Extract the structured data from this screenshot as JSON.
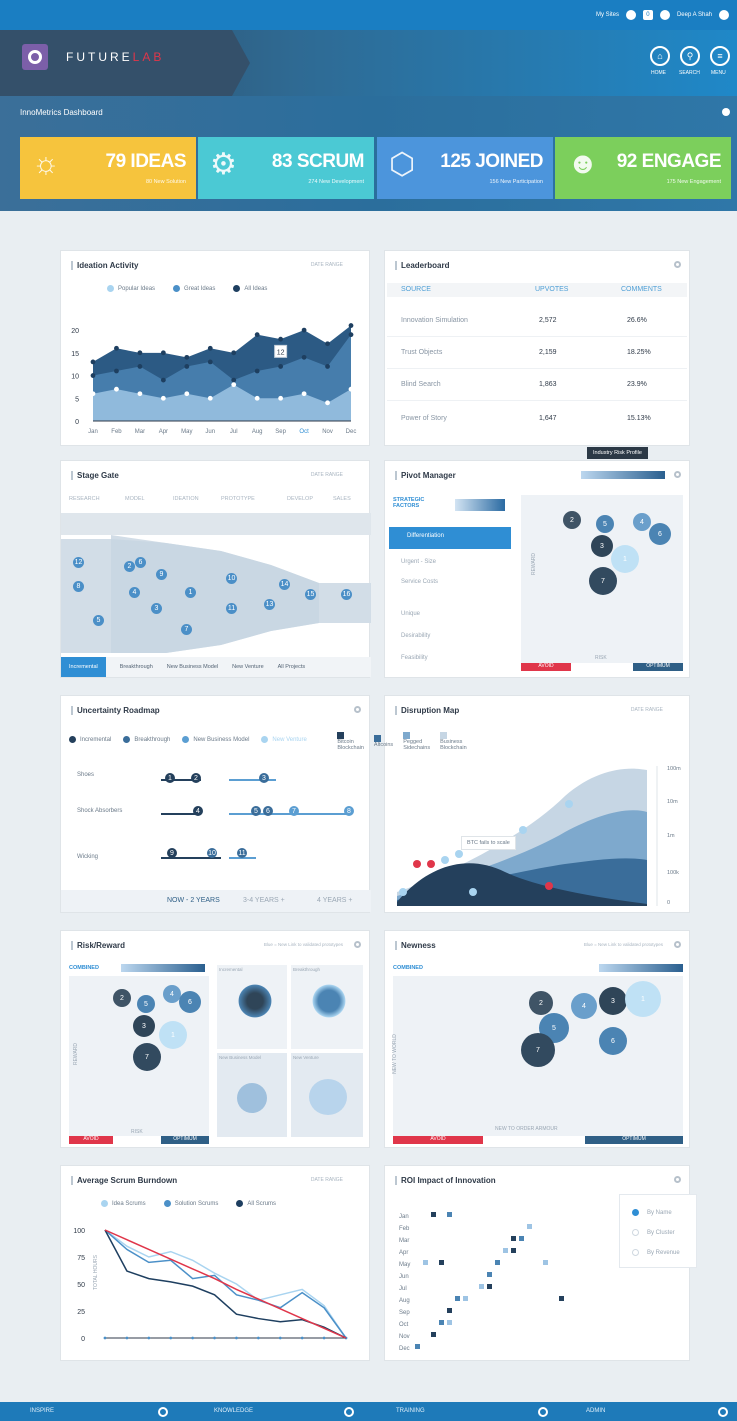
{
  "topbar": {
    "my_sites": "My Sites",
    "notif_count": "0",
    "user": "Deep A Shah"
  },
  "brand": {
    "name_a": "FUTURE",
    "name_b": "LAB"
  },
  "nav": {
    "home": "HOME",
    "search": "SEARCH",
    "menu": "MENU"
  },
  "dashboard_title": "InnoMetrics Dashboard",
  "tiles": [
    {
      "value": "79 IDEAS",
      "sub": "80 New Solution",
      "color": "#f6c43d",
      "icon": "lightbulb-icon"
    },
    {
      "value": "83 SCRUM",
      "sub": "274 New Development",
      "color": "#4bc9d4",
      "icon": "gears-icon"
    },
    {
      "value": "125 JOINED",
      "sub": "156 New Participation",
      "color": "#4c95dc",
      "icon": "network-icon"
    },
    {
      "value": "92 ENGAGE",
      "sub": "175 New Engagement",
      "color": "#7ccf5c",
      "icon": "users-icon"
    }
  ],
  "ideation": {
    "title": "Ideation Activity",
    "date_range": "DATE RANGE",
    "legend": [
      "Popular Ideas",
      "Great Ideas",
      "All Ideas"
    ],
    "tooltip": "12",
    "chart_data": {
      "type": "area",
      "categories": [
        "Jan",
        "Feb",
        "Mar",
        "Apr",
        "May",
        "Jun",
        "Jul",
        "Aug",
        "Sep",
        "Oct",
        "Nov",
        "Dec"
      ],
      "y_ticks": [
        20,
        15,
        10,
        5,
        0
      ],
      "ylim": [
        0,
        22
      ],
      "series": [
        {
          "name": "All Ideas",
          "values": [
            13,
            16,
            15,
            15,
            14,
            16,
            15,
            19,
            18,
            20,
            17,
            21
          ]
        },
        {
          "name": "Great Ideas",
          "values": [
            10,
            11,
            12,
            9,
            12,
            13,
            9,
            11,
            12,
            14,
            12,
            19
          ]
        },
        {
          "name": "Popular Ideas",
          "values": [
            6,
            7,
            6,
            5,
            6,
            5,
            8,
            5,
            5,
            6,
            4,
            7
          ]
        }
      ]
    }
  },
  "leaderboard": {
    "title": "Leaderboard",
    "columns": [
      "SOURCE",
      "UPVOTES",
      "COMMENTS"
    ],
    "rows": [
      [
        "Innovation Simulation",
        "2,572",
        "26.6%"
      ],
      [
        "Trust Objects",
        "2,159",
        "18.25%"
      ],
      [
        "Blind Search",
        "1,863",
        "23.9%"
      ],
      [
        "Power of Story",
        "1,647",
        "15.13%"
      ]
    ]
  },
  "stage_gate": {
    "title": "Stage Gate",
    "date_range": "DATE RANGE",
    "stages": [
      "RESEARCH",
      "MODEL",
      "IDEATION",
      "PROTOTYPE",
      "DEVELOP",
      "SALES"
    ],
    "tabs": [
      "Incremental",
      "Breakthrough",
      "New Business Model",
      "New Venture",
      "All Projects"
    ]
  },
  "pivot": {
    "title": "Pivot Manager",
    "tooltip": "Industry Risk Profile",
    "factors_title": "STRATEGIC FACTORS",
    "factors": [
      "Differentiation",
      "Urgent - Size",
      "Service Costs",
      "Unique",
      "Desirability",
      "Feasibility"
    ],
    "y_axis": "REWARD",
    "x_axis": "RISK",
    "scale": [
      "AVOID",
      "OPTIMUM"
    ],
    "bubbles": [
      "2",
      "5",
      "4",
      "6",
      "3",
      "1",
      "7"
    ]
  },
  "roadmap": {
    "title": "Uncertainty Roadmap",
    "legend": [
      "Incremental",
      "Breakthrough",
      "New Business Model",
      "New Venture"
    ],
    "rows": [
      "Shoes",
      "Shock Absorbers",
      "Wicking"
    ],
    "periods": [
      "NOW - 2 YEARS",
      "3-4 YEARS +",
      "4 YEARS +"
    ]
  },
  "disruption": {
    "title": "Disruption Map",
    "date_range": "DATE RANGE",
    "legend": [
      "Bitcoin Blockchain",
      "Altcoins",
      "Pegged Sidechains",
      "Business Blockchain"
    ],
    "tooltip": "BTC fails to scale",
    "y_ticks": [
      "100m",
      "10m",
      "1m",
      "100k",
      "0"
    ]
  },
  "risk_reward": {
    "title": "Risk/Reward",
    "note": "Blue = New Link to validated prototypes",
    "combined": "COMBINED",
    "y_axis": "REWARD",
    "x_axis": "RISK",
    "scale": [
      "AVOID",
      "OPTIMUM"
    ],
    "bubbles": [
      "2",
      "5",
      "4",
      "6",
      "3",
      "1",
      "7"
    ],
    "mini": [
      "Incremental",
      "Breakthrough",
      "New Business Model",
      "New Venture"
    ]
  },
  "newness": {
    "title": "Newness",
    "note": "Blue = New Link to validated prototypes",
    "combined": "COMBINED",
    "y_axis": "NEW TO WORLD",
    "x_axis": "NEW TO ORDER ARMOUR",
    "scale": [
      "AVOID",
      "OPTIMUM"
    ],
    "bubbles": [
      "2",
      "4",
      "3",
      "1",
      "5",
      "6",
      "7"
    ]
  },
  "burndown": {
    "title": "Average Scrum Burndown",
    "date_range": "DATE RANGE",
    "legend": [
      "Idea Scrums",
      "Solution Scrums",
      "All Scrums"
    ],
    "y_axis": "TOTAL HOURS",
    "chart_data": {
      "type": "line",
      "y_ticks": [
        100,
        75,
        50,
        25,
        0
      ],
      "ylim": [
        0,
        100
      ],
      "series": [
        {
          "name": "Idea Scrums",
          "values": [
            100,
            85,
            75,
            80,
            72,
            60,
            50,
            35,
            40,
            45,
            30,
            0
          ]
        },
        {
          "name": "Solution Scrums",
          "values": [
            100,
            82,
            70,
            72,
            55,
            58,
            40,
            35,
            28,
            42,
            28,
            0
          ]
        },
        {
          "name": "All Scrums",
          "values": [
            100,
            62,
            55,
            52,
            48,
            40,
            22,
            18,
            15,
            17,
            10,
            0
          ]
        },
        {
          "name": "Ideal",
          "values": [
            100,
            91,
            82,
            73,
            64,
            55,
            45,
            36,
            27,
            18,
            9,
            0
          ]
        }
      ]
    }
  },
  "roi": {
    "title": "ROI Impact of Innovation",
    "months": [
      "Jan",
      "Feb",
      "Mar",
      "Apr",
      "May",
      "Jun",
      "Jul",
      "Aug",
      "Sep",
      "Oct",
      "Nov",
      "Dec"
    ],
    "options": [
      "By Name",
      "By Cluster",
      "By Revenue"
    ]
  },
  "bottom": {
    "inspire": "INSPIRE",
    "knowledge": "KNOWLEDGE",
    "training": "TRAINING",
    "admin": "ADMIN"
  }
}
